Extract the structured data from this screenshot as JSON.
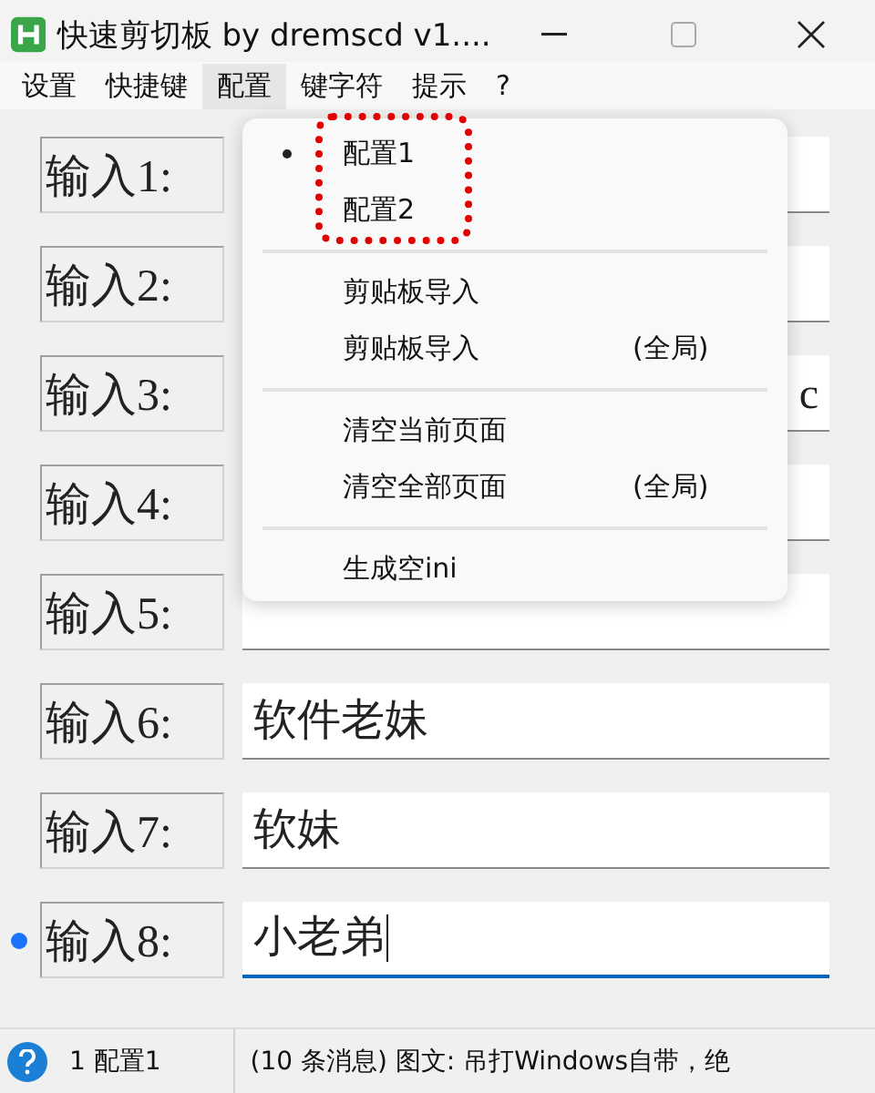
{
  "window": {
    "title": "快速剪切板 by dremscd v1...."
  },
  "menubar": [
    {
      "label": "设置",
      "selected": false
    },
    {
      "label": "快捷键",
      "selected": false
    },
    {
      "label": "配置",
      "selected": true
    },
    {
      "label": "键字符",
      "selected": false
    },
    {
      "label": "提示",
      "selected": false
    },
    {
      "label": "?",
      "selected": false
    }
  ],
  "dropdown": {
    "groups": [
      [
        {
          "label": "配置1",
          "selected": true
        },
        {
          "label": "配置2",
          "selected": false
        }
      ],
      [
        {
          "label": "剪贴板导入"
        },
        {
          "label": "剪贴板导入",
          "shortcut": "(全局)"
        }
      ],
      [
        {
          "label": "清空当前页面"
        },
        {
          "label": "清空全部页面",
          "shortcut": "(全局)"
        }
      ],
      [
        {
          "label": "生成空ini"
        }
      ]
    ],
    "highlight_outline": true
  },
  "inputs": [
    {
      "label": "输入1:",
      "focused": false
    },
    {
      "label": "输入2:",
      "focused": false
    },
    {
      "label": "输入3:",
      "value": "c",
      "scrolled_to_end": true,
      "focused": false
    },
    {
      "label": "输入4:",
      "focused": false
    },
    {
      "label": "输入5:",
      "focused": false
    },
    {
      "label": "输入6:",
      "value": "软件老妹",
      "focused": false
    },
    {
      "label": "输入7:",
      "value": "软妹",
      "focused": false
    },
    {
      "label": "输入8:",
      "value": "小老弟",
      "focused": true
    }
  ],
  "status_bar": {
    "config": "1 配置1",
    "message": "(10 条消息) 图文: 吊打Windows自带，绝"
  }
}
